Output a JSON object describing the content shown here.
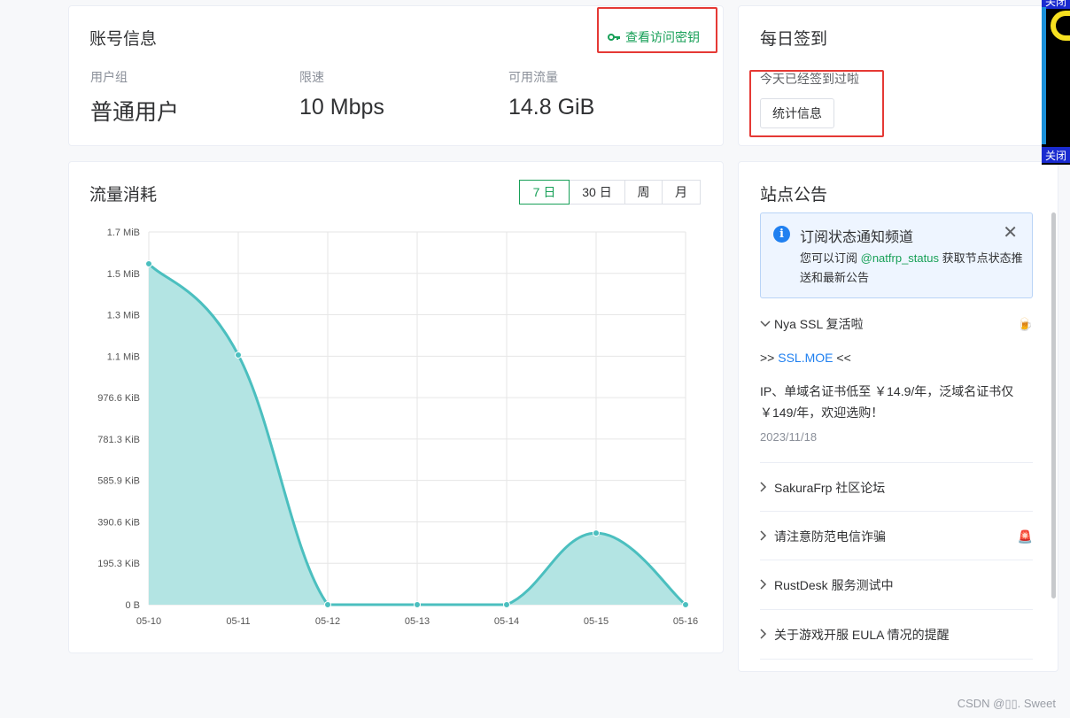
{
  "account": {
    "title": "账号信息",
    "key_link": "查看访问密钥",
    "stats": [
      {
        "label": "用户组",
        "value": "普通用户"
      },
      {
        "label": "限速",
        "value": "10 Mbps"
      },
      {
        "label": "可用流量",
        "value": "14.8 GiB"
      }
    ]
  },
  "checkin": {
    "title": "每日签到",
    "status": "今天已经签到过啦",
    "button": "统计信息"
  },
  "traffic": {
    "title": "流量消耗",
    "tabs": [
      "7 日",
      "30 日",
      "周",
      "月"
    ],
    "active_tab": 0
  },
  "chart_data": {
    "type": "area",
    "title": "",
    "xlabel": "",
    "ylabel": "",
    "categories": [
      "05-10",
      "05-11",
      "05-12",
      "05-13",
      "05-14",
      "05-15",
      "05-16"
    ],
    "series": [
      {
        "values_mib": [
          1.57,
          1.15,
          0,
          0,
          0,
          0.33,
          0
        ]
      }
    ],
    "y_ticks": [
      "0 B",
      "195.3 KiB",
      "390.6 KiB",
      "585.9 KiB",
      "781.3 KiB",
      "976.6 KiB",
      "1.1 MiB",
      "1.3 MiB",
      "1.5 MiB",
      "1.7 MiB"
    ],
    "ylim_mib": [
      0,
      1.7166
    ],
    "grid": true,
    "color_line": "#4bbfbf",
    "color_fill": "#b3e4e3"
  },
  "notices": {
    "title": "站点公告",
    "alert": {
      "title": "订阅状态通知频道",
      "body_prefix": "您可以订阅 ",
      "body_link": "@natfrp_status",
      "body_suffix": " 获取节点状态推送和最新公告",
      "close": "✕"
    },
    "expanded": {
      "title": "Nya SSL 复活啦",
      "emoji": "🍺",
      "link_prefix": ">> ",
      "link": "SSL.MOE",
      "link_suffix": " <<",
      "text": "IP、单域名证书低至 ￥14.9/年，泛域名证书仅 ￥149/年，欢迎选购！",
      "date": "2023/11/18"
    },
    "items": [
      {
        "title": "SakuraFrp 社区论坛",
        "emoji": ""
      },
      {
        "title": "请注意防范电信诈骗",
        "emoji": "🚨"
      },
      {
        "title": "RustDesk 服务测试中",
        "emoji": ""
      },
      {
        "title": "关于游戏开服 EULA 情况的提醒",
        "emoji": ""
      }
    ]
  },
  "overlay": {
    "close_top": "关闭",
    "close_bottom": "关闭"
  },
  "watermark": "CSDN @▯▯. Sweet"
}
